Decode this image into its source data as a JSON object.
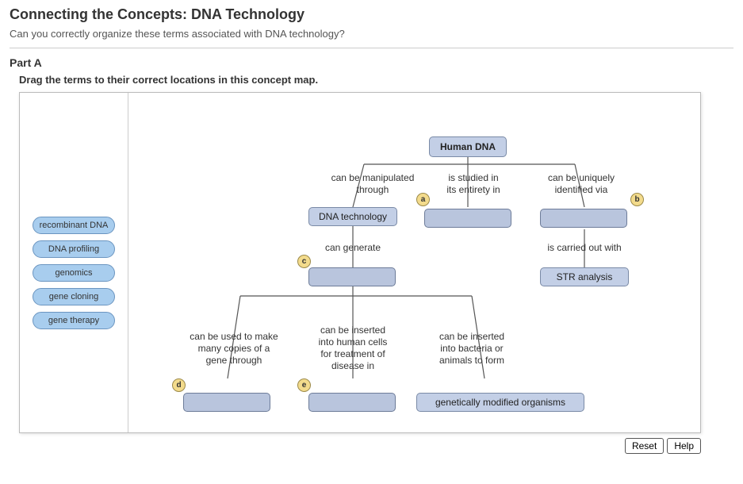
{
  "header": {
    "title": "Connecting the Concepts: DNA Technology",
    "subtitle": "Can you correctly organize these terms associated with DNA technology?"
  },
  "part": {
    "label": "Part A",
    "instruction": "Drag the terms to their correct locations in this concept map."
  },
  "palette": {
    "terms": [
      "recombinant DNA",
      "DNA profiling",
      "genomics",
      "gene cloning",
      "gene therapy"
    ]
  },
  "nodes": {
    "root": "Human DNA",
    "dna_tech": "DNA technology",
    "str": "STR analysis",
    "gmo": "genetically modified organisms"
  },
  "link_labels": {
    "l1": "can be manipulated\nthrough",
    "l2": "is studied in\nits entirety in",
    "l3": "can be uniquely\nidentified via",
    "l4": "can generate",
    "l5": "is carried out with",
    "l6": "can be used to make\nmany copies of a\ngene through",
    "l7": "can be inserted\ninto human cells\nfor treatment of\ndisease in",
    "l8": "can be inserted\ninto bacteria or\nanimals to form"
  },
  "badges": {
    "a": "a",
    "b": "b",
    "c": "c",
    "d": "d",
    "e": "e"
  },
  "buttons": {
    "reset": "Reset",
    "help": "Help"
  }
}
